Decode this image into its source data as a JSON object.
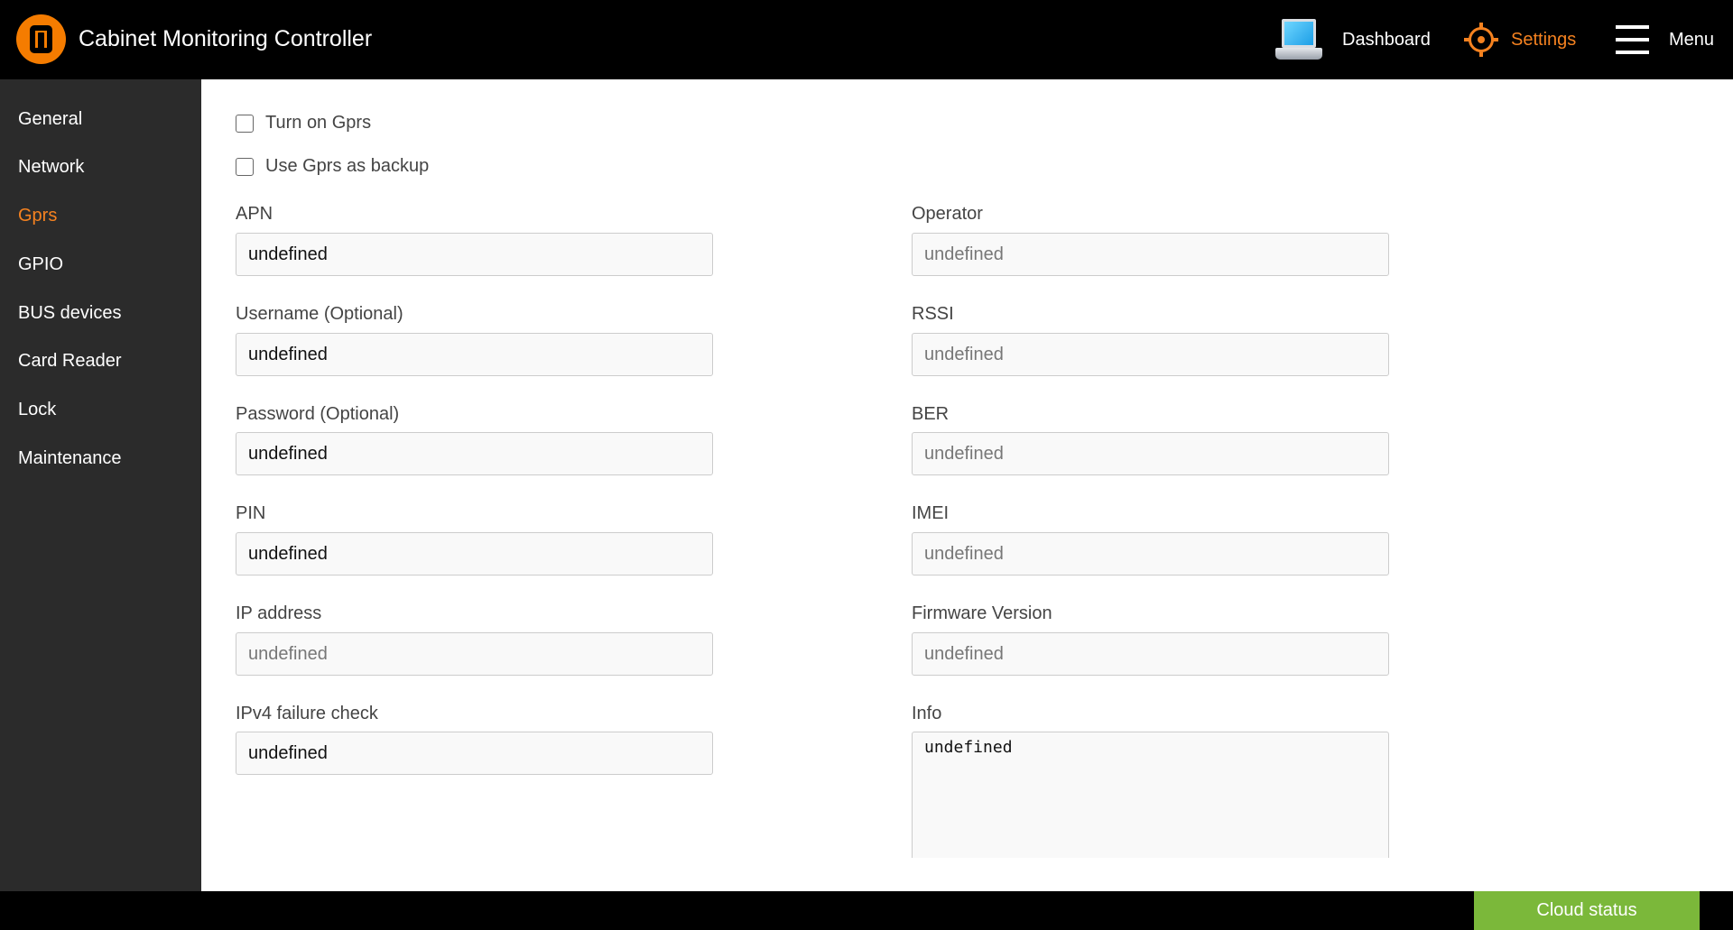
{
  "header": {
    "app_title": "Cabinet Monitoring Controller",
    "logo_icon": "orange-ring-logo",
    "nav": {
      "dashboard_label": "Dashboard",
      "dashboard_icon": "laptop-icon",
      "settings_label": "Settings",
      "settings_icon": "gear-icon",
      "menu_label": "Menu",
      "menu_icon": "hamburger-icon"
    },
    "accent_color": "#f58220"
  },
  "sidebar": {
    "items": [
      {
        "label": "General",
        "active": false
      },
      {
        "label": "Network",
        "active": false
      },
      {
        "label": "Gprs",
        "active": true
      },
      {
        "label": "GPIO",
        "active": false
      },
      {
        "label": "BUS devices",
        "active": false
      },
      {
        "label": "Card Reader",
        "active": false
      },
      {
        "label": "Lock",
        "active": false
      },
      {
        "label": "Maintenance",
        "active": false
      }
    ]
  },
  "gprs": {
    "turn_on_label": "Turn on Gprs",
    "turn_on_checked": false,
    "backup_label": "Use Gprs as backup",
    "backup_checked": false,
    "left_fields": [
      {
        "label": "APN",
        "value": "undefined"
      },
      {
        "label": "Username (Optional)",
        "value": "undefined"
      },
      {
        "label": "Password (Optional)",
        "value": "undefined"
      },
      {
        "label": "PIN",
        "value": "undefined"
      },
      {
        "label": "IP address",
        "value": "undefined"
      },
      {
        "label": "IPv4 failure check",
        "value": "undefined"
      }
    ],
    "right_fields": [
      {
        "label": "Operator",
        "value": "undefined"
      },
      {
        "label": "RSSI",
        "value": "undefined"
      },
      {
        "label": "BER",
        "value": "undefined"
      },
      {
        "label": "IMEI",
        "value": "undefined"
      },
      {
        "label": "Firmware Version",
        "value": "undefined"
      }
    ],
    "info": {
      "label": "Info",
      "value": "undefined"
    }
  },
  "footer": {
    "cloud_status_label": "Cloud status",
    "cloud_status_color": "#7bb83a"
  }
}
